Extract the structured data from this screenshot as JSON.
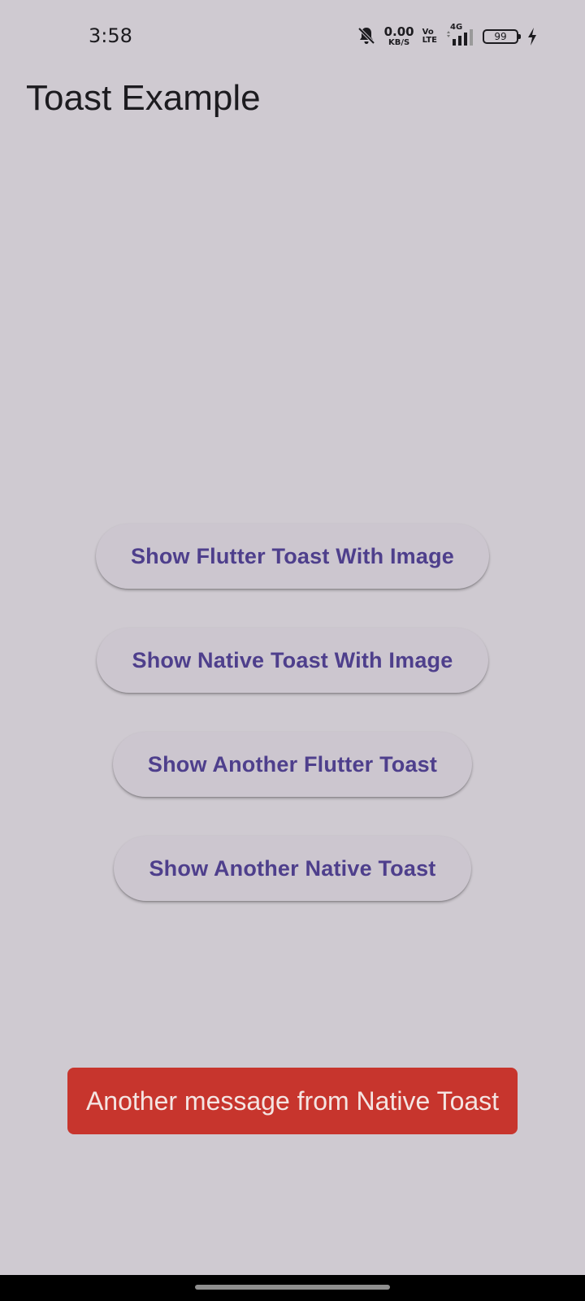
{
  "status_bar": {
    "time": "3:58",
    "net_speed_value": "0.00",
    "net_speed_unit": "KB/S",
    "volte_top": "Vo",
    "volte_bottom": "LTE",
    "network_type": "4G",
    "battery_level": "99",
    "icons": [
      "bell-off-icon",
      "signal-icon",
      "battery-icon",
      "charging-bolt-icon"
    ]
  },
  "app_bar": {
    "title": "Toast Example"
  },
  "buttons": [
    {
      "label": "Show Flutter Toast With Image"
    },
    {
      "label": "Show Native Toast With Image"
    },
    {
      "label": "Show Another Flutter Toast"
    },
    {
      "label": "Show Another Native Toast"
    }
  ],
  "toast": {
    "message": "Another message from Native Toast",
    "color": "#c7352d"
  },
  "colors": {
    "background": "#cfcad1",
    "button_text": "#4e3f8c",
    "button_background": "#ccc6cf"
  }
}
